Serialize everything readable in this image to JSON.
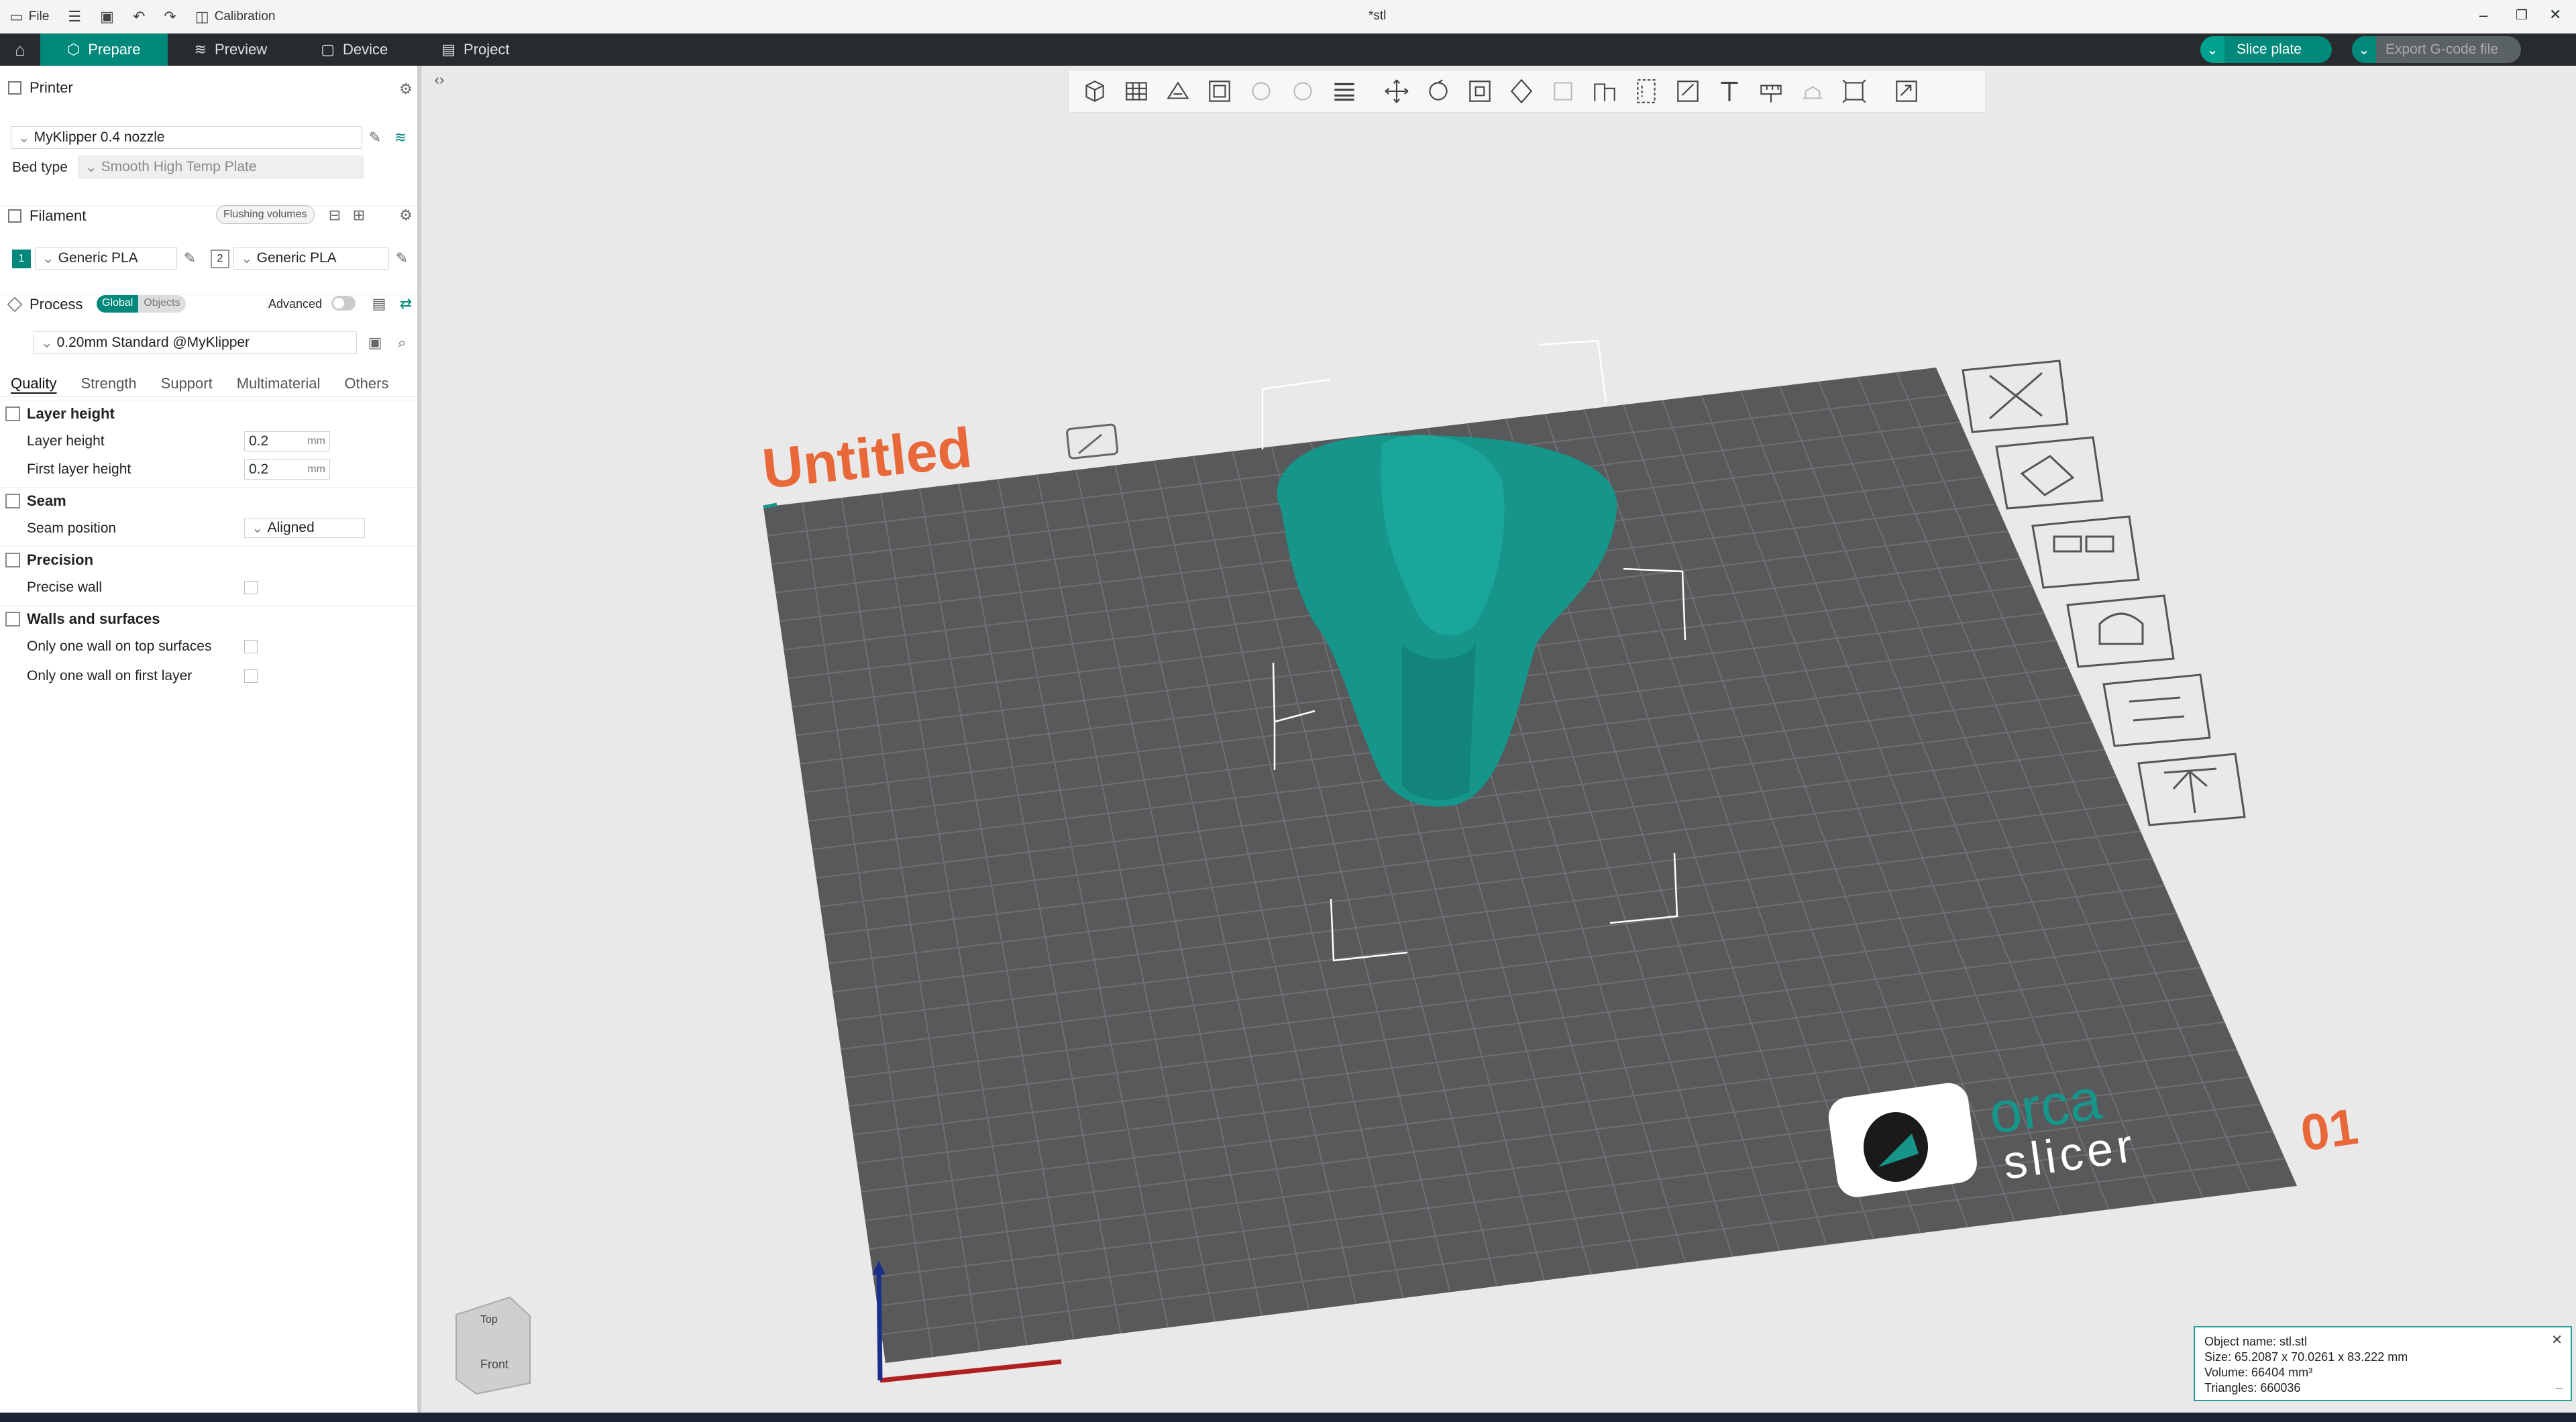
{
  "titlebar": {
    "file_label": "File",
    "calibration_label": "Calibration",
    "document_title": "*stl"
  },
  "nav": {
    "tabs": [
      {
        "label": "Prepare"
      },
      {
        "label": "Preview"
      },
      {
        "label": "Device"
      },
      {
        "label": "Project"
      }
    ],
    "slice_label": "Slice plate",
    "export_label": "Export G-code file"
  },
  "printer": {
    "section_title": "Printer",
    "preset": "MyKlipper 0.4 nozzle",
    "bed_type_label": "Bed type",
    "bed_type_value": "Smooth High Temp Plate"
  },
  "filament": {
    "section_title": "Filament",
    "flushing_label": "Flushing volumes",
    "slots": [
      {
        "index": "1",
        "name": "Generic PLA"
      },
      {
        "index": "2",
        "name": "Generic PLA"
      }
    ]
  },
  "process": {
    "section_title": "Process",
    "global_label": "Global",
    "objects_label": "Objects",
    "advanced_label": "Advanced",
    "preset": "0.20mm Standard @MyKlipper",
    "tabs": [
      "Quality",
      "Strength",
      "Support",
      "Multimaterial",
      "Others"
    ]
  },
  "quality": {
    "layer_height_group": "Layer height",
    "layer_height_label": "Layer height",
    "layer_height_value": "0.2",
    "first_layer_height_label": "First layer height",
    "first_layer_height_value": "0.2",
    "unit": "mm",
    "seam_group": "Seam",
    "seam_position_label": "Seam position",
    "seam_position_value": "Aligned",
    "precision_group": "Precision",
    "precise_wall_label": "Precise wall",
    "walls_group": "Walls and surfaces",
    "one_wall_top_label": "Only one wall on top surfaces",
    "one_wall_first_label": "Only one wall on first layer"
  },
  "plate": {
    "name": "Untitled",
    "number": "01",
    "logo_top": "orca",
    "logo_bottom": "slicer"
  },
  "navcube": {
    "top_label": "Top",
    "front_label": "Front"
  },
  "object_info": {
    "name_line": "Object name: stl.stl",
    "size_line": "Size: 65.2087 x 70.0261 x 83.222 mm",
    "volume_line": "Volume: 66404 mm³",
    "triangles_line": "Triangles: 660036"
  },
  "colors": {
    "accent": "#00897b",
    "plate": "#58595b",
    "model": "#16958a",
    "brand_orange": "#e8683a"
  }
}
